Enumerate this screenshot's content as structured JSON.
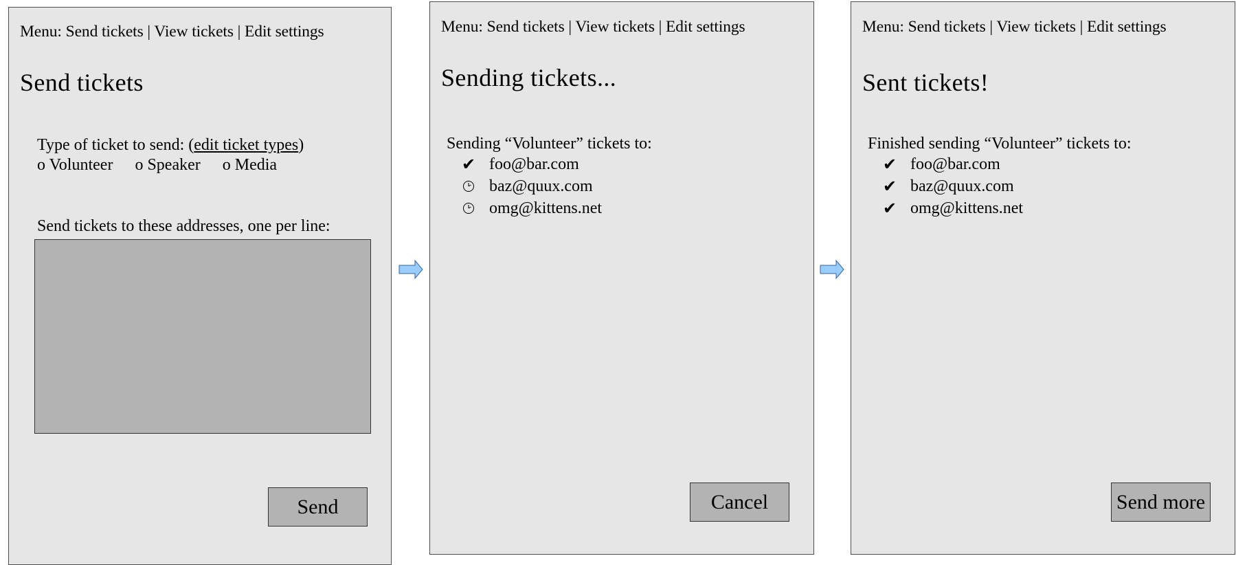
{
  "menu": "Menu: Send tickets | View tickets | Edit settings",
  "panel1": {
    "title": "Send tickets",
    "ticket_type_prefix": "Type of ticket to send: (",
    "edit_link": "edit ticket types",
    "ticket_type_suffix": ")",
    "radio_options": [
      "o Volunteer",
      "o Speaker",
      "o Media"
    ],
    "addresses_label": "Send tickets to these addresses, one per line:",
    "send_button": "Send"
  },
  "panel2": {
    "title": "Sending tickets...",
    "status_text": "Sending “Volunteer” tickets to:",
    "items": [
      {
        "email": "foo@bar.com",
        "status": "check-icon"
      },
      {
        "email": "baz@quux.com",
        "status": "clock-icon"
      },
      {
        "email": "omg@kittens.net",
        "status": "clock-icon"
      }
    ],
    "cancel_button": "Cancel"
  },
  "panel3": {
    "title": "Sent tickets!",
    "status_text": "Finished sending “Volunteer” tickets to:",
    "items": [
      {
        "email": "foo@bar.com",
        "status": "check-icon"
      },
      {
        "email": "baz@quux.com",
        "status": "check-icon"
      },
      {
        "email": "omg@kittens.net",
        "status": "check-icon"
      }
    ],
    "send_more_button": "Send more"
  },
  "icons": {
    "check_glyph": "✔",
    "arrow": "right-arrow-icon"
  },
  "colors": {
    "panel_bg": "#e6e6e6",
    "control_bg": "#b3b3b3",
    "arrow_fill": "#99ccff"
  }
}
